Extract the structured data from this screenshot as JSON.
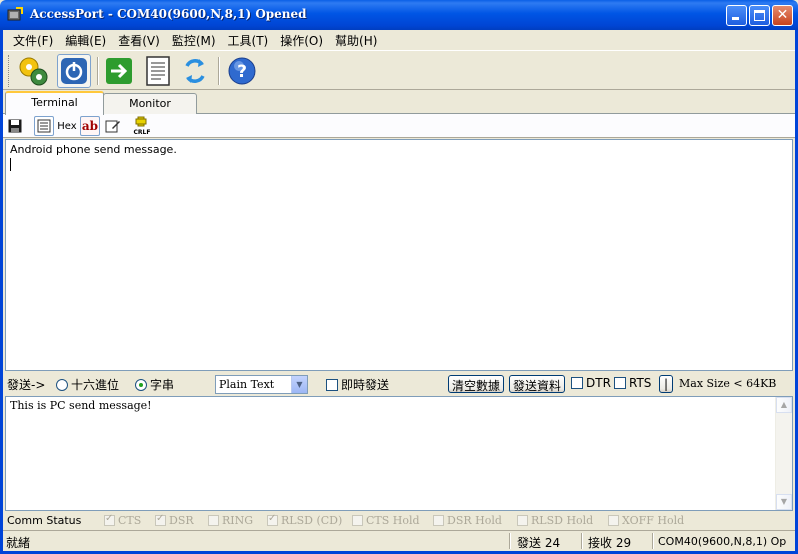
{
  "window": {
    "title": "AccessPort - COM40(9600,N,8,1) Opened"
  },
  "menu": [
    "文件(F)",
    "編輯(E)",
    "查看(V)",
    "監控(M)",
    "工具(T)",
    "操作(O)",
    "幫助(H)"
  ],
  "toolbar": {
    "icons": [
      "gear-settings-icon",
      "power-icon",
      "green-arrow-icon",
      "document-icon",
      "refresh-icon",
      "help-icon"
    ]
  },
  "tabs": [
    "Terminal",
    "Monitor"
  ],
  "subtoolbar": {
    "hex_label": "Hex",
    "ab_label": "ab",
    "crlf_label": "CRLF"
  },
  "receive": {
    "text": "Android phone send message."
  },
  "send_options": {
    "label": "發送->",
    "radio_hex": "十六進位",
    "radio_char": "字串",
    "format_selected": "Plain Text",
    "realtime_send": "即時發送",
    "clear_button": "清空數據",
    "send_button": "發送資料",
    "dtr": "DTR",
    "rts": "RTS",
    "pipe_button": "|",
    "max_size": "Max Size < 64KB"
  },
  "send": {
    "text": "This is PC send message!"
  },
  "comm_status": {
    "label": "Comm Status",
    "flags": [
      {
        "label": "CTS",
        "checked": true
      },
      {
        "label": "DSR",
        "checked": true
      },
      {
        "label": "RING",
        "checked": false
      },
      {
        "label": "RLSD (CD)",
        "checked": true
      },
      {
        "label": "CTS Hold",
        "checked": false
      },
      {
        "label": "DSR Hold",
        "checked": false
      },
      {
        "label": "RLSD Hold",
        "checked": false
      },
      {
        "label": "XOFF Hold",
        "checked": false
      }
    ]
  },
  "statusbar": {
    "ready": "就緒",
    "sent": "發送 24",
    "received": "接收 29",
    "port": "COM40(9600,N,8,1) Op"
  },
  "colors": {
    "titlebar": "#0055E5",
    "face": "#ECE9D8",
    "accent_tab": "#FFC83C"
  }
}
